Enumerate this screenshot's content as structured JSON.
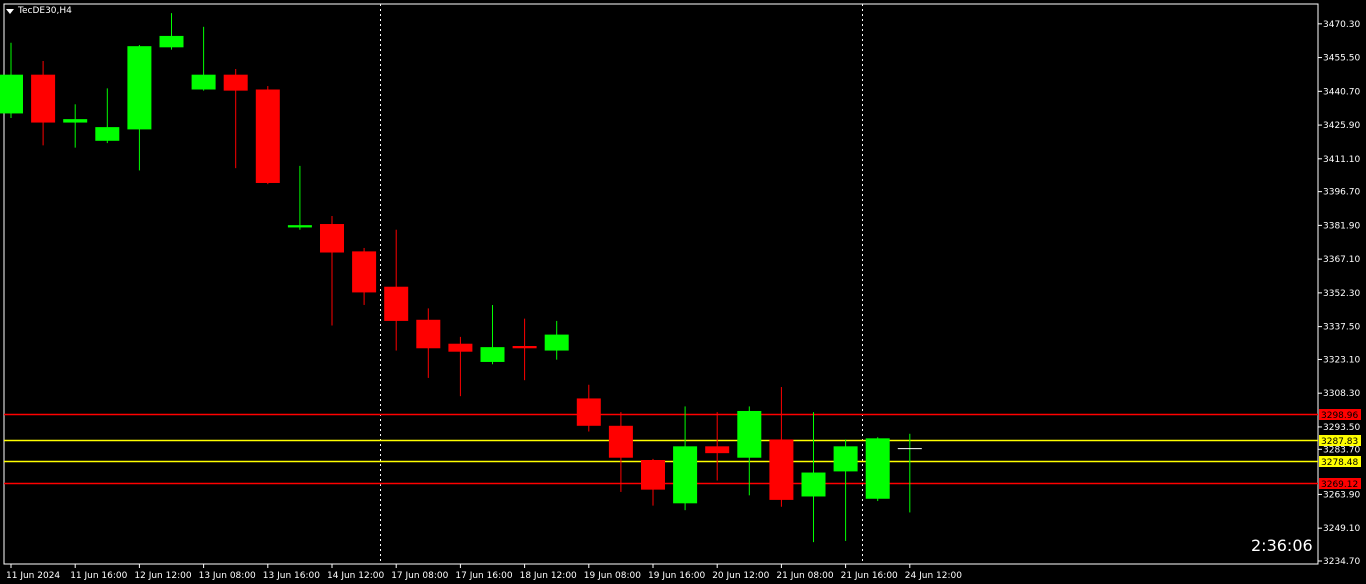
{
  "symbol": "TecDE30,H4",
  "timer": "2:36:06",
  "colors": {
    "background": "#000000",
    "bull": "#00FF00",
    "bear": "#FF0000",
    "wick_bull": "#00FF00",
    "wick_bear": "#FF0000",
    "grid_separator": "#FFFFFF",
    "axis": "#FFFFFF",
    "level_red": "#FF0000",
    "level_yellow": "#FFFF00"
  },
  "chart_data": {
    "type": "candlestick",
    "ylim": [
      3234.7,
      3479.0
    ],
    "y_ticks": [
      3470.3,
      3455.5,
      3440.7,
      3425.9,
      3411.1,
      3396.7,
      3381.9,
      3367.1,
      3352.3,
      3337.5,
      3323.1,
      3308.3,
      3293.5,
      3283.7,
      3263.9,
      3249.1,
      3234.7
    ],
    "y_tick_labels": [
      "3470.30",
      "3455.50",
      "3440.70",
      "3425.90",
      "3411.10",
      "3396.70",
      "3381.90",
      "3367.10",
      "3352.30",
      "3337.50",
      "3323.10",
      "3308.30",
      "3293.50",
      "3283.70",
      "3263.90",
      "3249.10",
      "3234.70"
    ],
    "x_labels": [
      "11 Jun 2024",
      "11 Jun 16:00",
      "12 Jun 12:00",
      "13 Jun 08:00",
      "13 Jun 16:00",
      "14 Jun 12:00",
      "17 Jun 08:00",
      "17 Jun 16:00",
      "18 Jun 12:00",
      "19 Jun 08:00",
      "19 Jun 16:00",
      "20 Jun 12:00",
      "21 Jun 08:00",
      "21 Jun 16:00",
      "24 Jun 12:00"
    ],
    "x_label_candle_index": [
      0,
      2,
      4,
      6,
      8,
      10,
      12,
      14,
      16,
      18,
      20,
      22,
      24,
      26,
      28
    ],
    "separator_candle_index": [
      11.5,
      26.5
    ],
    "candles": [
      {
        "o": 3431.0,
        "h": 3462.0,
        "l": 3429.0,
        "c": 3448.0
      },
      {
        "o": 3448.0,
        "h": 3454.0,
        "l": 3417.0,
        "c": 3427.0
      },
      {
        "o": 3427.0,
        "h": 3435.0,
        "l": 3416.0,
        "c": 3428.5
      },
      {
        "o": 3419.0,
        "h": 3442.0,
        "l": 3418.0,
        "c": 3425.0
      },
      {
        "o": 3424.0,
        "h": 3461.0,
        "l": 3406.0,
        "c": 3460.5
      },
      {
        "o": 3460.0,
        "h": 3475.0,
        "l": 3459.0,
        "c": 3465.0
      },
      {
        "o": 3441.5,
        "h": 3469.0,
        "l": 3441.0,
        "c": 3448.0
      },
      {
        "o": 3448.0,
        "h": 3450.5,
        "l": 3407.0,
        "c": 3441.0
      },
      {
        "o": 3441.5,
        "h": 3443.0,
        "l": 3400.0,
        "c": 3400.5
      },
      {
        "o": 3381.0,
        "h": 3408.0,
        "l": 3380.0,
        "c": 3382.0
      },
      {
        "o": 3382.5,
        "h": 3386.0,
        "l": 3338.0,
        "c": 3370.0
      },
      {
        "o": 3370.5,
        "h": 3372.0,
        "l": 3347.0,
        "c": 3352.5
      },
      {
        "o": 3355.0,
        "h": 3380.0,
        "l": 3327.0,
        "c": 3340.0
      },
      {
        "o": 3340.5,
        "h": 3345.5,
        "l": 3315.0,
        "c": 3328.0
      },
      {
        "o": 3330.0,
        "h": 3333.0,
        "l": 3307.0,
        "c": 3326.5
      },
      {
        "o": 3322.0,
        "h": 3347.0,
        "l": 3321.0,
        "c": 3328.5
      },
      {
        "o": 3329.0,
        "h": 3341.0,
        "l": 3314.0,
        "c": 3328.0
      },
      {
        "o": 3327.0,
        "h": 3340.0,
        "l": 3323.0,
        "c": 3334.0
      },
      {
        "o": 3306.0,
        "h": 3312.0,
        "l": 3291.5,
        "c": 3294.0
      },
      {
        "o": 3294.0,
        "h": 3300.0,
        "l": 3265.0,
        "c": 3280.0
      },
      {
        "o": 3279.0,
        "h": 3279.5,
        "l": 3259.0,
        "c": 3266.0
      },
      {
        "o": 3260.0,
        "h": 3302.5,
        "l": 3257.0,
        "c": 3285.0
      },
      {
        "o": 3285.0,
        "h": 3300.0,
        "l": 3270.0,
        "c": 3282.0
      },
      {
        "o": 3280.0,
        "h": 3302.5,
        "l": 3263.5,
        "c": 3300.5
      },
      {
        "o": 3288.0,
        "h": 3311.0,
        "l": 3258.5,
        "c": 3261.5
      },
      {
        "o": 3263.0,
        "h": 3300.0,
        "l": 3243.0,
        "c": 3273.5
      },
      {
        "o": 3274.0,
        "h": 3288.0,
        "l": 3243.5,
        "c": 3285.0
      },
      {
        "o": 3262.0,
        "h": 3289.0,
        "l": 3261.0,
        "c": 3288.5
      },
      {
        "o": 3284.0,
        "h": 3290.5,
        "l": 3256.0,
        "c": 3284.0
      }
    ],
    "levels": [
      {
        "price": 3298.96,
        "label": "3298.96",
        "color": "#FF0000"
      },
      {
        "price": 3287.83,
        "label": "3287.83",
        "color": "#FFFF00"
      },
      {
        "price": 3278.48,
        "label": "3278.48",
        "color": "#FFFF00"
      },
      {
        "price": 3269.12,
        "label": "3269.12",
        "color": "#FF0000"
      }
    ]
  }
}
